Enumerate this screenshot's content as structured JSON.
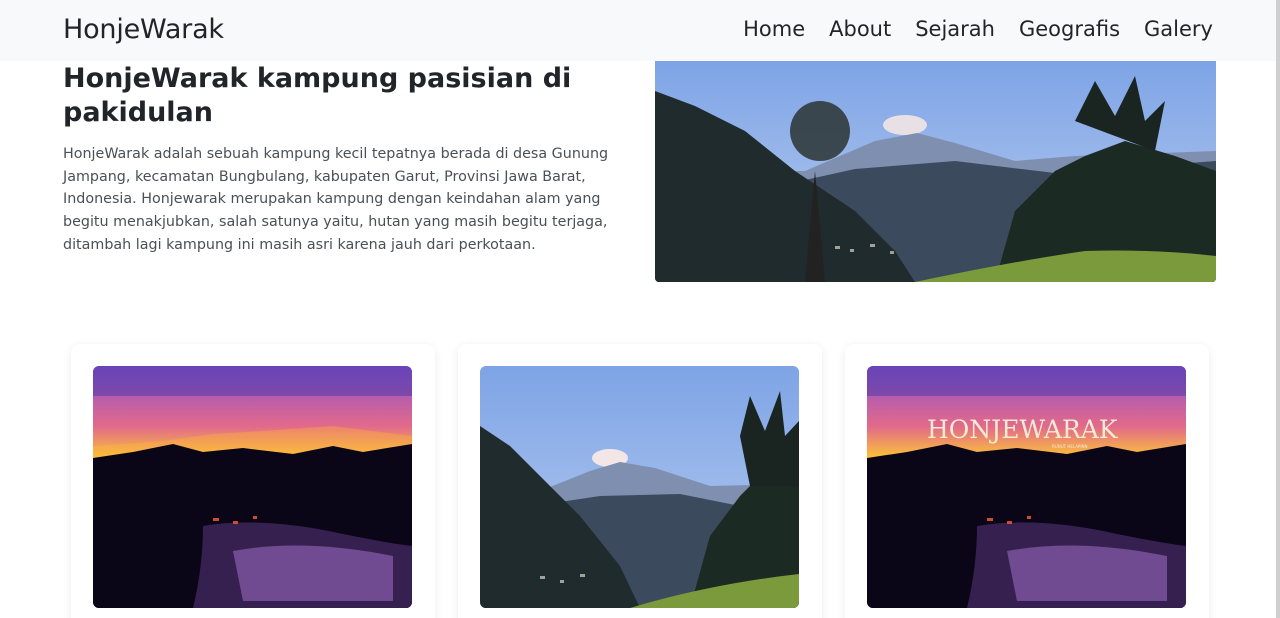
{
  "navbar": {
    "brand": "HonjeWarak",
    "links": [
      {
        "label": "Home"
      },
      {
        "label": "About"
      },
      {
        "label": "Sejarah"
      },
      {
        "label": "Geografis"
      },
      {
        "label": "Galery"
      }
    ]
  },
  "hero": {
    "title": "HonjeWarak kampung pasisian di pakidulan",
    "paragraph": "HonjeWarak adalah sebuah kampung kecil tepatnya berada di desa Gunung Jampang, kecamatan Bungbulang, kabupaten Garut, Provinsi Jawa Barat, Indonesia. Honjewarak merupakan kampung dengan keindahan alam yang begitu menakjubkan, salah satunya yaitu, hutan yang masih begitu terjaga, ditambah lagi kampung ini masih asri karena jauh dari perkotaan.",
    "image": "mountain-landscape-photo"
  },
  "gallery": {
    "cards": [
      {
        "image": "sunset-rice-field-photo"
      },
      {
        "image": "mountain-landscape-photo"
      },
      {
        "image": "sunset-rice-field-photo",
        "overlay_text": "HONJEWARAK",
        "overlay_subtext": "RUNUT HELAPINN"
      }
    ]
  },
  "colors": {
    "navbar_bg": "#f8f9fa",
    "text": "#212529",
    "muted_text": "#495057"
  }
}
